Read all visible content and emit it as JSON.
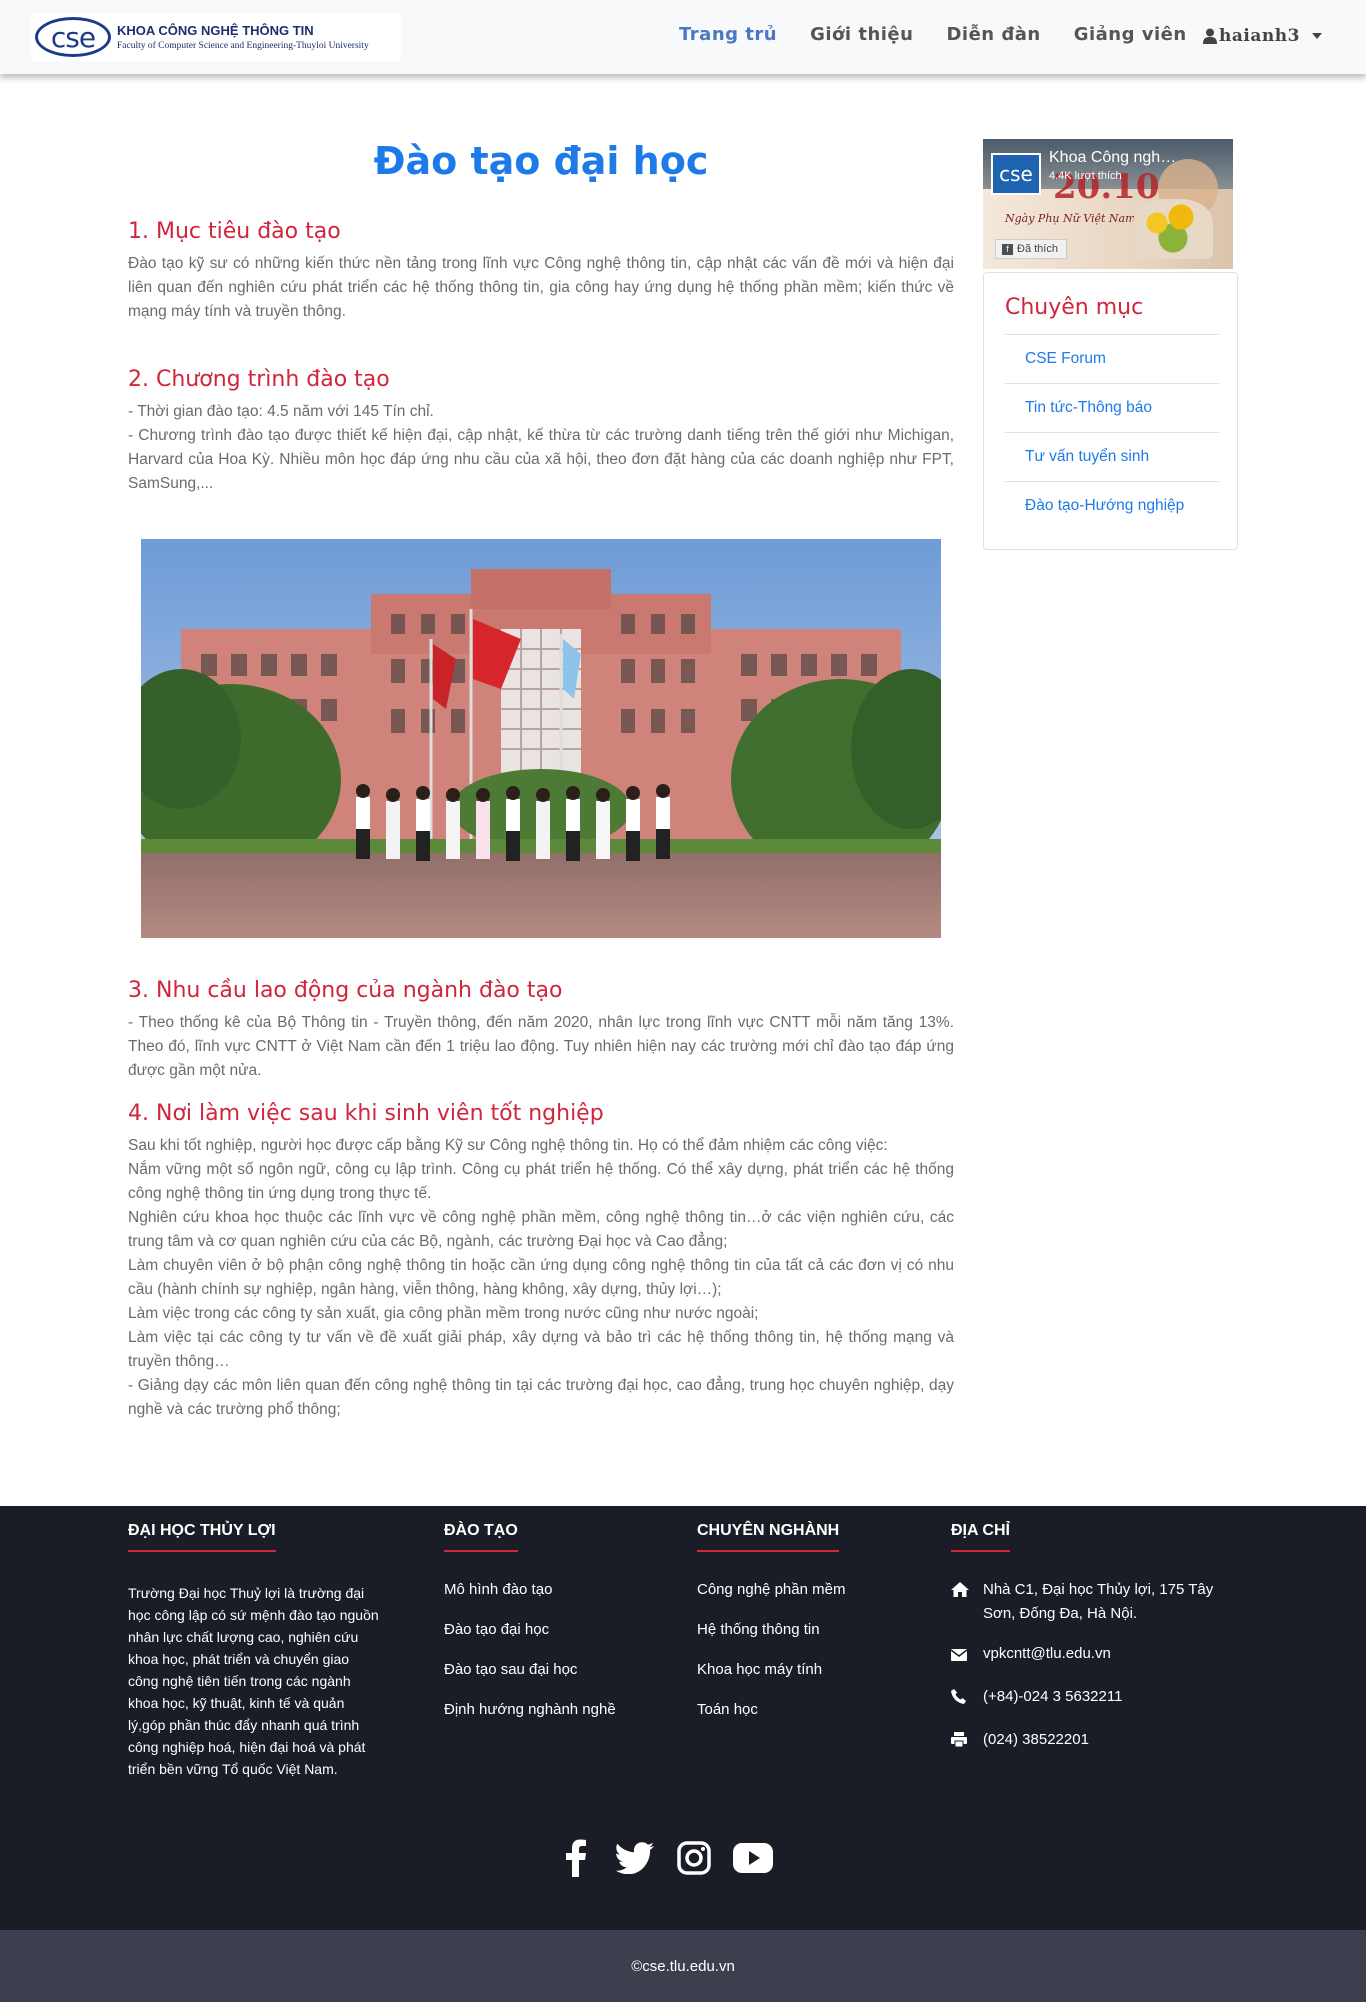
{
  "navbar": {
    "logo_title": "KHOA CÔNG NGHỆ THÔNG TIN",
    "logo_subtitle": "Faculty of Computer Science and Engineering-Thuyloi University",
    "logo_mark": "cse",
    "items": [
      {
        "label": "Trang trủ",
        "active": true
      },
      {
        "label": "Giới thiệu",
        "active": false
      },
      {
        "label": "Diễn đàn",
        "active": false
      },
      {
        "label": "Giảng viên",
        "active": false
      }
    ],
    "user": "haianh3",
    "accent_color": "#4a78c2"
  },
  "page": {
    "title": "Đào tạo đại học",
    "sections": [
      {
        "heading": "1. Mục tiêu đào tạo",
        "paragraphs": [
          "Đào tạo kỹ sư có những kiến thức nền tảng trong lĩnh vực Công nghệ thông tin, cập nhật các vấn đề mới và hiện đại liên quan đến nghiên cứu phát triển các hệ thống thông tin, gia công hay ứng dụng hệ thống phần mềm; kiến thức về mạng máy tính và truyền thông."
        ]
      },
      {
        "heading": "2. Chương trình đào tạo",
        "paragraphs": [
          "- Thời gian đào tạo: 4.5 năm với 145 Tín chỉ.",
          "- Chương trình đào tạo được thiết kế hiện đại, cập nhật, kế thừa từ các trường danh tiếng trên thế giới như Michigan, Harvard của Hoa Kỳ. Nhiều môn học đáp ứng nhu cầu của xã hội, theo đơn đặt hàng của các doanh nghiệp như FPT, SamSung,..."
        ]
      },
      {
        "heading": "3. Nhu cầu lao động của ngành đào tạo",
        "paragraphs": [
          "- Theo thống kê của Bộ Thông tin - Truyền thông, đến năm 2020, nhân lực trong lĩnh vực CNTT mỗi năm tăng 13%. Theo đó, lĩnh vực CNTT ở Việt Nam cần đến 1 triệu lao động. Tuy nhiên hiện nay các trường mới chỉ đào tạo đáp ứng được gần một nửa."
        ]
      },
      {
        "heading": "4. Nơi làm việc sau khi sinh viên tốt nghiệp",
        "paragraphs": [
          "Sau khi tốt nghiệp, người học được cấp bằng Kỹ sư Công nghệ thông tin. Họ có thể đảm nhiệm các công việc:",
          "Nắm vững một số ngôn ngữ, công cụ lập trình. Công cụ phát triển hệ thống. Có thể xây dựng, phát triển các hệ thống công nghệ thông tin ứng dụng trong thực tế.",
          "Nghiên cứu khoa học thuộc các lĩnh vực về công nghệ phần mềm, công nghệ thông tin…ở các viện nghiên cứu, các trung tâm và cơ quan nghiên cứu của các Bộ, ngành, các trường Đại học và Cao đẳng;",
          "Làm chuyên viên ở bộ phận công nghệ thông tin hoặc cần ứng dụng công nghệ thông tin của tất cả các đơn vị có nhu cầu (hành chính sự nghiệp, ngân hàng, viễn thông, hàng không, xây dựng, thủy lợi…);",
          "Làm việc trong các công ty sản xuất, gia công phần mềm trong nước cũng như nước ngoài;",
          "Làm việc tại các công ty tư vấn về đề xuất giải pháp, xây dựng và bảo trì các hệ thống thông tin, hệ thống mạng và truyền thông…",
          "- Giảng dạy các môn liên quan đến công nghệ thông tin tại các trường đại học, cao đẳng, trung học chuyên nghiệp, dạy nghề và các trường phổ thông;"
        ]
      }
    ],
    "heading_color": "#d0263b",
    "title_color": "#1e7ae8"
  },
  "sidebar": {
    "fb": {
      "page_name": "Khoa Công ngh…",
      "likes": "4.4K lượt thích",
      "like_button": "Đã thích",
      "logo": "cse",
      "banner_date": "20.10",
      "banner_caption": "Ngày Phụ Nữ Việt Nam"
    },
    "category_title": "Chuyên mục",
    "categories": [
      "CSE Forum",
      "Tin tức-Thông báo",
      "Tư vấn tuyển sinh",
      "Đào tạo-Hướng nghiệp"
    ]
  },
  "footer": {
    "about": {
      "heading": "ĐẠI HỌC THỦY LỢI",
      "text": "Trường Đại học Thuỷ lợi là trường đại học công lập có sứ mệnh đào tạo nguồn nhân lực chất lượng cao, nghiên cứu khoa học, phát triển và chuyển giao công nghệ tiên tiến trong các ngành khoa học, kỹ thuật, kinh tế và quản lý,góp phần thúc đẩy nhanh quá trình công nghiệp hoá, hiện đại hoá và phát triển bền vững Tổ quốc Việt Nam."
    },
    "training": {
      "heading": "ĐÀO TẠO",
      "items": [
        "Mô hình đào tạo",
        "Đào tạo đại học",
        "Đào tạo sau đại học",
        "Định hướng nghành nghề"
      ]
    },
    "majors": {
      "heading": "CHUYÊN NGHÀNH",
      "items": [
        "Công nghệ phần mềm",
        "Hệ thống thông tin",
        "Khoa học máy tính",
        "Toán học"
      ]
    },
    "address": {
      "heading": "ĐỊA CHỈ",
      "location": "Nhà C1, Đại học Thủy lợi, 175 Tây Sơn, Đống Đa, Hà Nội.",
      "email": "vpkcntt@tlu.edu.vn",
      "phone": "(+84)-024 3 5632211",
      "fax": "(024) 38522201"
    },
    "social_icons": [
      "facebook-icon",
      "twitter-icon",
      "instagram-icon",
      "youtube-icon"
    ],
    "copyright": "©cse.tlu.edu.vn"
  }
}
